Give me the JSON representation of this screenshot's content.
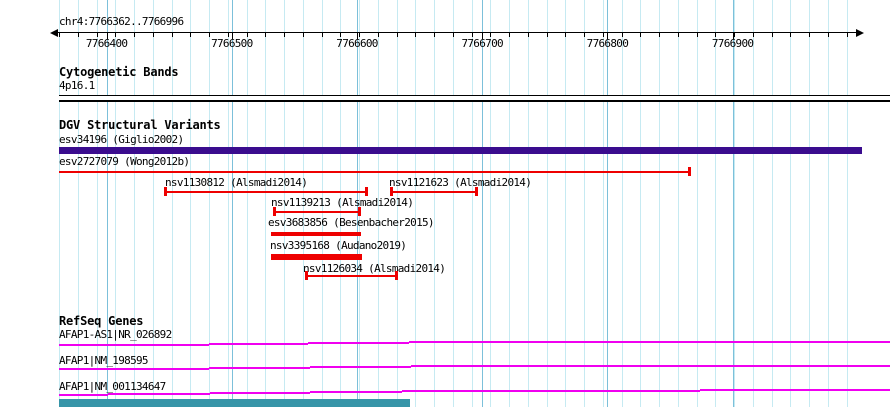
{
  "region": {
    "title": "chr4:7766362..7766996"
  },
  "ruler": {
    "ticks": [
      "7766400",
      "7766500",
      "7766600",
      "7766700",
      "7766800",
      "7766900"
    ]
  },
  "colors": {
    "grid_minor": "#c6eaf2",
    "grid_major": "#7cc0da",
    "variant_red": "#ee0000",
    "variant_purple": "#3a0c8e",
    "gene_magenta": "#f000f0",
    "partial_track_teal": "#3795a8",
    "axis_black": "#000000"
  },
  "sections": {
    "cytobands": {
      "header": "Cytogenetic Bands",
      "band_label": "4p16.1"
    },
    "dgv": {
      "header": "DGV Structural Variants",
      "variants": [
        {
          "id": "esv34196",
          "label": "esv34196 (Giglio2002)"
        },
        {
          "id": "esv2727079",
          "label": "esv2727079 (Wong2012b)"
        },
        {
          "id": "nsv1130812",
          "label": "nsv1130812 (Alsmadi2014)"
        },
        {
          "id": "nsv1121623",
          "label": "nsv1121623 (Alsmadi2014)"
        },
        {
          "id": "nsv1139213",
          "label": "nsv1139213 (Alsmadi2014)"
        },
        {
          "id": "esv3683856",
          "label": "esv3683856 (Besenbacher2015)"
        },
        {
          "id": "nsv3395168",
          "label": "nsv3395168 (Audano2019)"
        },
        {
          "id": "nsv1126034",
          "label": "nsv1126034 (Alsmadi2014)"
        }
      ]
    },
    "refseq": {
      "header": "RefSeq Genes",
      "genes": [
        {
          "id": "AFAP1-AS1_NR_026892",
          "label": "AFAP1-AS1|NR_026892"
        },
        {
          "id": "AFAP1_NM_198595",
          "label": "AFAP1|NM_198595"
        },
        {
          "id": "AFAP1_NM_001134647",
          "label": "AFAP1|NM_001134647"
        }
      ]
    }
  }
}
